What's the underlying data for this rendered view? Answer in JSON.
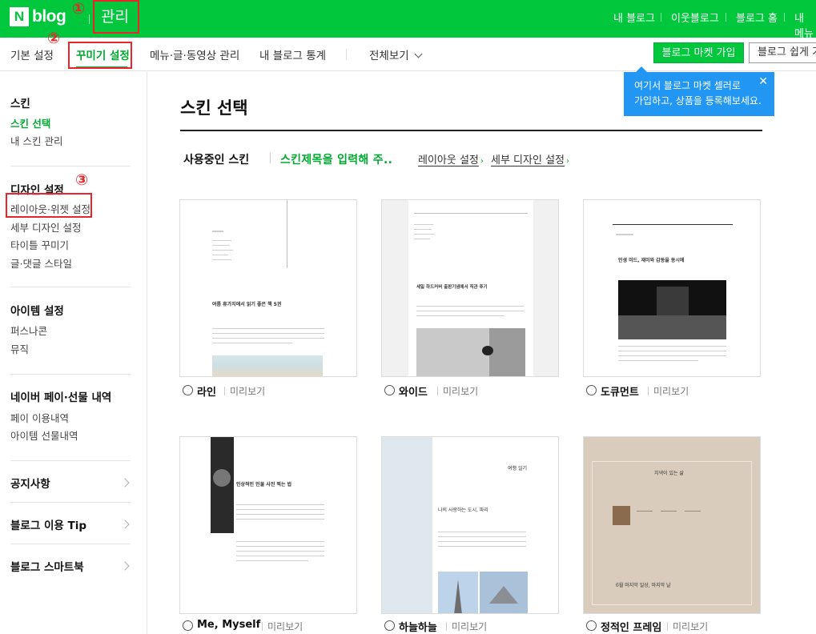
{
  "header": {
    "logo_letter": "N",
    "logo_text": "blog",
    "title": "관리",
    "nav": [
      "내 블로그",
      "이웃블로그",
      "블로그 홈",
      "내 메뉴"
    ]
  },
  "annotations": [
    "①",
    "②",
    "③"
  ],
  "tabs": [
    {
      "label": "기본 설정",
      "active": false
    },
    {
      "label": "꾸미기 설정",
      "active": true
    },
    {
      "label": "메뉴·글·동영상 관리",
      "active": false
    },
    {
      "label": "내 블로그 통계",
      "active": false
    },
    {
      "label": "전체보기",
      "active": false
    }
  ],
  "buttons": {
    "market": "블로그 마켓 가입",
    "easy": "블로그 쉽게 가입"
  },
  "tooltip": {
    "line1": "여기서 블로그 마켓 셀러로",
    "line2": "가입하고, 상품을 등록해보세요."
  },
  "sidebar": {
    "skin": {
      "heading": "스킨",
      "items": [
        "스킨 선택",
        "내 스킨 관리"
      ]
    },
    "design": {
      "heading": "디자인 설정",
      "items": [
        "레이아웃·위젯 설정",
        "세부 디자인 설정",
        "타이틀 꾸미기",
        "글·댓글 스타일"
      ]
    },
    "item": {
      "heading": "아이템 설정",
      "items": [
        "퍼스나콘",
        "뮤직"
      ]
    },
    "pay": {
      "heading": "네이버 페이·선물 내역",
      "items": [
        "페이 이용내역",
        "아이템 선물내역"
      ]
    },
    "notice": "공지사항",
    "tip": "블로그 이용 Tip",
    "smartbook": "블로그 스마트북"
  },
  "main": {
    "title": "스킨 선택",
    "current_label": "사용중인 스킨",
    "skin_name": "스킨제목을 입력해 주..",
    "layout_link": "레이아웃 설정",
    "detail_link": "세부 디자인 설정"
  },
  "skins": [
    {
      "name": "라인",
      "preview": "미리보기",
      "headline": "여름 휴가지에서 읽기 좋은 책 5권"
    },
    {
      "name": "와이드",
      "preview": "미리보기",
      "headline": "세일 하드커버 출판기념에서 직관 후기"
    },
    {
      "name": "도큐먼트",
      "preview": "미리보기",
      "headline": "인생 미드, 재미와 감동을 동시에"
    },
    {
      "name": "Me, Myself",
      "preview": "미리보기",
      "headline": "인상적인 인물 사진 찍는 법"
    },
    {
      "name": "하늘하늘",
      "preview": "미리보기",
      "headline": "나의 사랑하는 도시, 파리",
      "badge": "여행 일기"
    },
    {
      "name": "정적인 프레임",
      "preview": "미리보기",
      "headline": "6월 마지막 일상, 마지막 날",
      "badge": "치넥이 있는 삶"
    }
  ],
  "colors": {
    "brand": "#00c73c",
    "accent_text": "#00a930",
    "tooltip": "#2196f3",
    "annotation": "#e8252b"
  }
}
